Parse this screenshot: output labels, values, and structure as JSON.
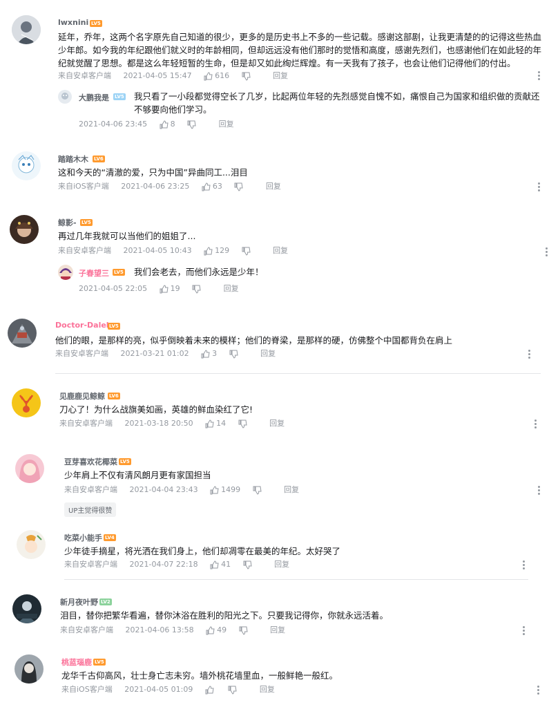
{
  "labels": {
    "reply": "回复"
  },
  "colors": {
    "level_badge": "#ff9a2e",
    "level_badge_lv2": "#8bd29b",
    "pink_username": "#fb7299",
    "meta_gray": "#9499a0"
  },
  "comments": [
    {
      "user": "lwxnini",
      "level": "LV5",
      "text": "延年，乔年，这两个名字原先自己知道的很少，更多的是历史书上不多的一些记载。感谢这部剧，让我更清楚的的记得这些热血少年郎。如今我的年纪跟他们就义时的年龄相同，但却远远没有他们那时的觉悟和高度，感谢先烈们，也感谢他们在如此轻的年纪就觉醒了思想。都是这么年轻短暂的生命，但是却又如此绚烂辉煌。有一天我有了孩子，也会让他们记得他们的付出。",
      "source": "来自安卓客户端",
      "time": "2021-04-05 15:47",
      "likes": "616",
      "reply": {
        "user": "大鹏我是",
        "level": "LV5",
        "text": "我只看了一小段都觉得空长了几岁，比起两位年轻的先烈感觉自愧不如，痛恨自己为国家和组织做的贡献还不够要向他们学习。",
        "time": "2021-04-06 23:45",
        "likes": "8"
      }
    },
    {
      "user": "踏踏木木",
      "level": "LV6",
      "text": "这和今天的“清澈的爱，只为中国”异曲同工...泪目",
      "source": "来自iOS客户端",
      "time": "2021-04-06 23:25",
      "likes": "63"
    },
    {
      "user": "鲸影-",
      "level": "LV5",
      "text": "再过几年我就可以当他们的姐姐了...",
      "source": "来自安卓客户端",
      "time": "2021-04-05 10:43",
      "likes": "129",
      "reply": {
        "user": "子春望三",
        "level": "LV5",
        "text": "我们会老去，而他们永远是少年！",
        "time": "2021-04-05 22:05",
        "likes": "19"
      }
    },
    {
      "user": "Doctor-Dalek",
      "level": "LV5",
      "text": "他们的眼，是那样的亮，似乎倒映着未来的模样；他们的脊梁，是那样的硬，仿佛整个中国都背负在肩上",
      "source": "来自安卓客户端",
      "time": "2021-03-21 01:02",
      "likes": "3"
    },
    {
      "user": "见鹿鹿见鲸鲸",
      "level": "LV6",
      "text": "刀心了！为什么战旗美如画，英雄的鲜血染红了它!",
      "source": "来自安卓客户端",
      "time": "2021-03-18 20:50",
      "likes": "14"
    },
    {
      "user": "豆芽喜欢花椰菜",
      "level": "LV5",
      "text": "少年肩上不仅有清风朗月更有家国担当",
      "source": "来自安卓客户端",
      "time": "2021-04-04 23:43",
      "likes": "1499",
      "badge": "UP主觉得很赞"
    },
    {
      "user": "吃菜小能手",
      "level": "LV4",
      "text": "少年徒手摘星，将光洒在我们身上，他们却凋零在最美的年纪。太好哭了",
      "source": "来自安卓客户端",
      "time": "2021-04-07 22:18",
      "likes": "41"
    },
    {
      "user": "新月夜叶野",
      "level": "LV2",
      "text": "泪目，替你把繁华看遍，替你沐浴在胜利的阳光之下。只要我记得你，你就永远活着。",
      "source": "来自安卓客户端",
      "time": "2021-04-06 13:58",
      "likes": "49"
    },
    {
      "user": "桃蓝瑙鹿",
      "level": "LV5",
      "text": "龙华千古仰高风，壮士身亡志未穷。墙外桃花墙里血，一般鲜艳一般红。",
      "source": "来自iOS客户端",
      "time": "2021-04-05 01:09",
      "likes": ""
    }
  ]
}
